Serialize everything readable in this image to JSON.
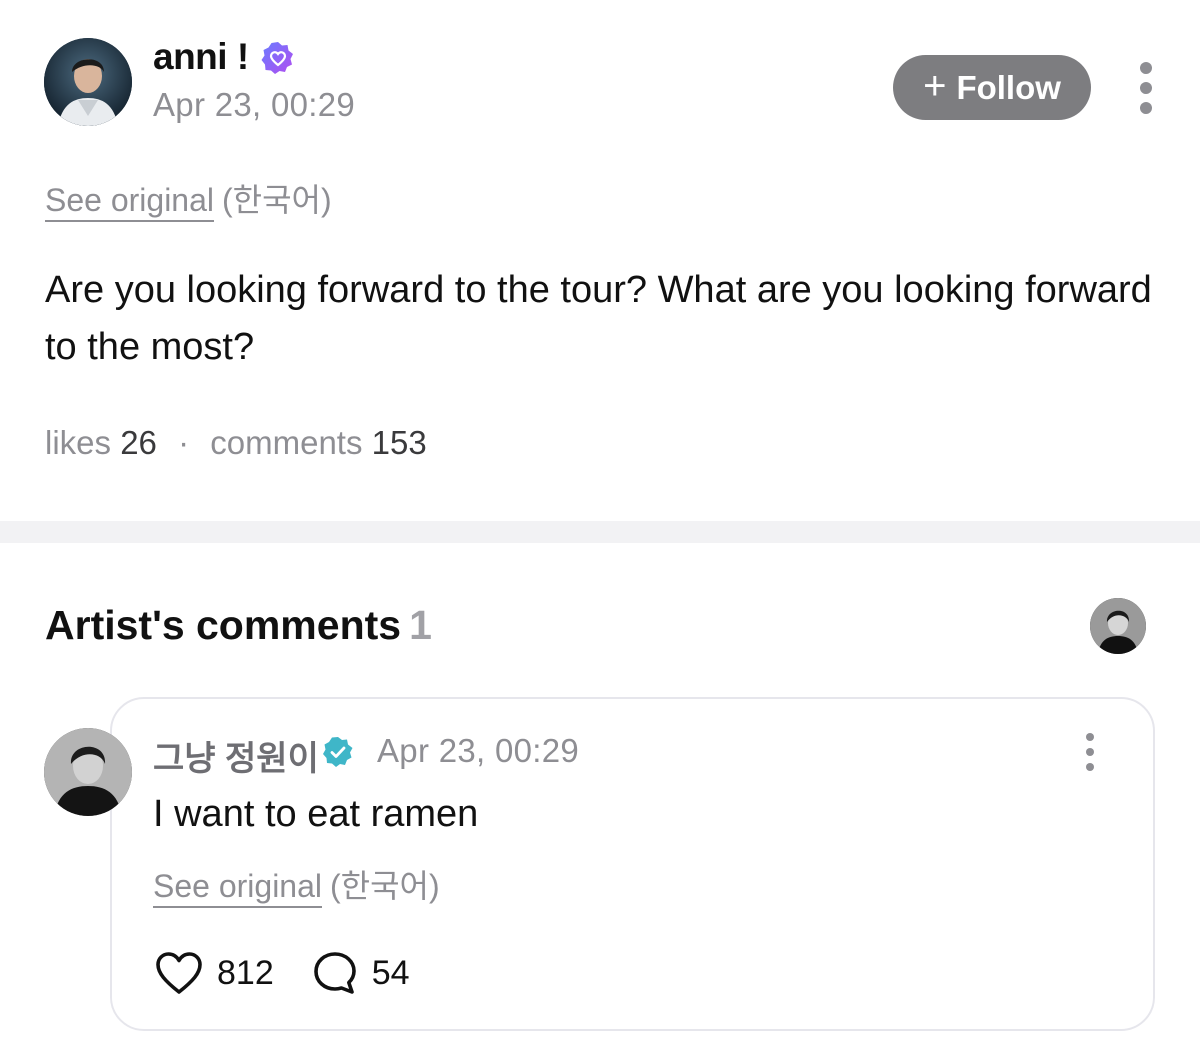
{
  "post": {
    "author_name": "anni !",
    "timestamp": "Apr 23, 00:29",
    "follow_label": "Follow",
    "see_original": "See original",
    "original_language": "(한국어)",
    "body": "Are you looking forward to the tour? What are you looking forward to the most?",
    "stats": {
      "likes_label": "likes",
      "likes_count": "26",
      "separator": "·",
      "comments_label": "comments",
      "comments_count": "153"
    }
  },
  "artist_comments": {
    "title": "Artist's comments",
    "count": "1",
    "comment": {
      "author_name": "그냥 정원이",
      "timestamp": "Apr 23, 00:29",
      "text": "I want to eat ramen",
      "see_original": "See original",
      "original_language": "(한국어)",
      "likes_count": "812",
      "replies_count": "54"
    }
  },
  "colors": {
    "follow_button": "#7d7d80",
    "verified_author": "#8b5cf6",
    "verified_artist": "#3fb6c8",
    "muted_text": "#8e8e93",
    "divider": "#f2f2f4"
  },
  "icons": [
    "verified-badge-icon",
    "plus-icon",
    "more-vertical-icon",
    "heart-icon",
    "comment-bubble-icon"
  ]
}
